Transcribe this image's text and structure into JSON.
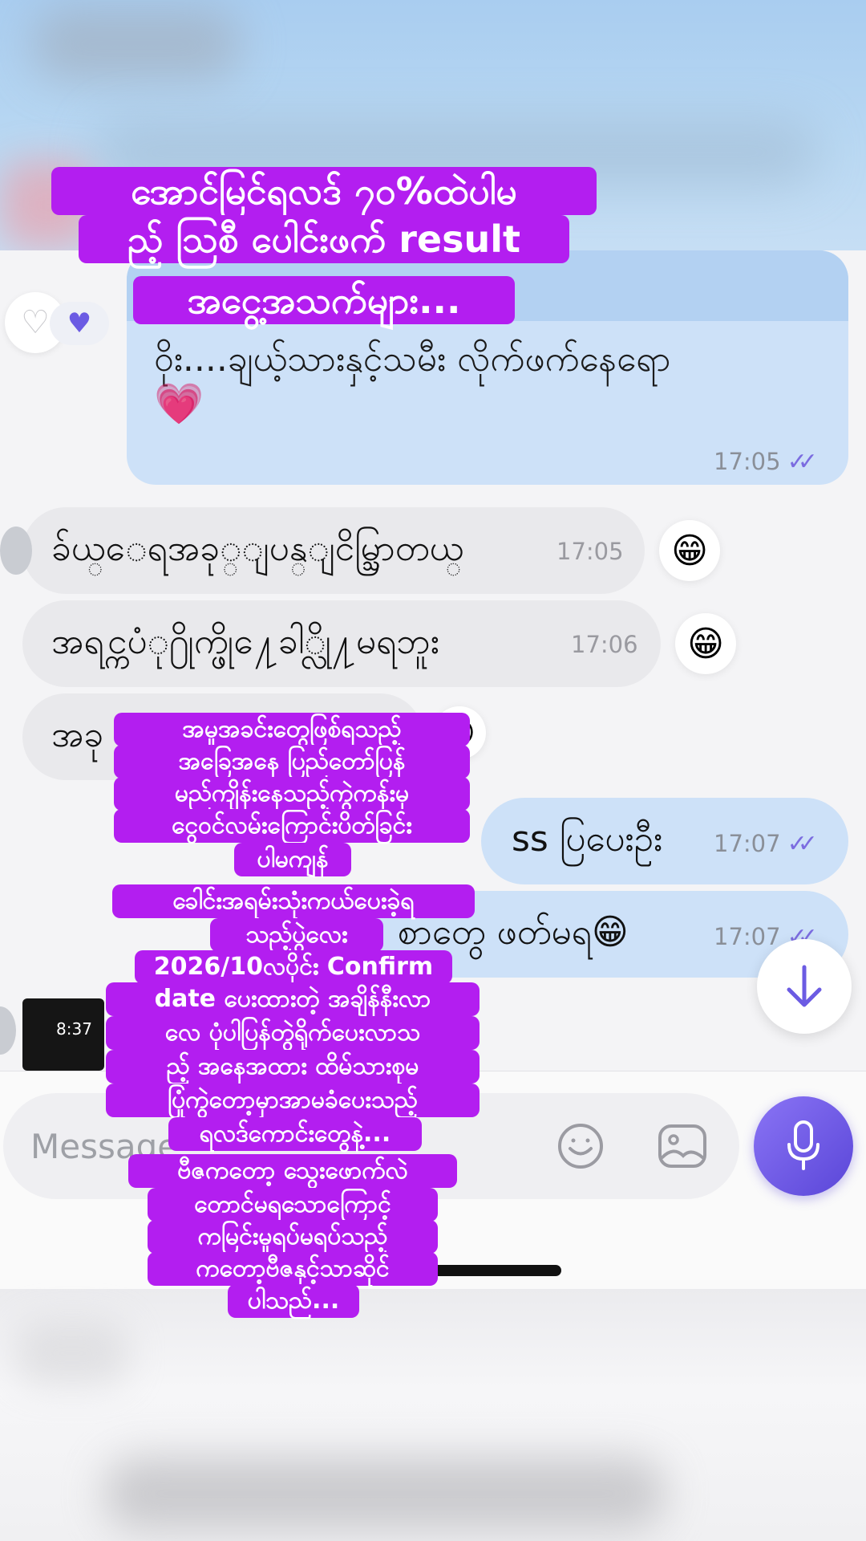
{
  "colors": {
    "accent": "#6b5be3",
    "outgoing_bubble": "#cde1f8",
    "incoming_bubble": "#e9e9ec",
    "caption_bg": "#b31ef0"
  },
  "messages": {
    "outgoing_long": {
      "text": "ဝိုး....ချယ့်သားနှင့်သမီး  လိုက်ဖက်နေရော",
      "emoji": "💗",
      "time": "17:05",
      "status_icon": "double-check-icon"
    },
    "incoming": [
      {
        "text": "ခ်ယ္ေရအခု္ျပန္ျငိမ္သြာတယ္",
        "time": "17:05",
        "reaction": "😁"
      },
      {
        "text": "အရင္ကပံု႐ိုက္ဖို႔ေခါ္လို႔မရဘူး",
        "time": "17:06",
        "reaction": "😁"
      },
      {
        "text": "အခု",
        "time": "",
        "reaction": "😁"
      }
    ],
    "outgoing_short": [
      {
        "text": "ss ပြပေးဦး",
        "time": "17:07",
        "status_icon": "double-check-icon"
      },
      {
        "text": "စာတွေ ဖတ်မရ😁",
        "time": "17:07",
        "status_icon": "double-check-icon"
      }
    ],
    "thumbnail_time": "8:37"
  },
  "composer": {
    "placeholder": "Message"
  },
  "captions": {
    "top": [
      "အောင်မြင်ရလဒ် ၇၀%ထဲပါမ",
      "ည့် ဩစီ ပေါင်းဖက် result",
      "အငွေ့အသက်များ..."
    ],
    "middle": [
      "အမှုအခင်းတွေဖြစ်ရသည့်",
      "အခြေအနေ ပြည်တော်ပြန်",
      "မည်ကျိန်းနေသည့်ကွဲကန်းမှ",
      "ငွေဝင်လမ်းကြောင်းပိတ်ခြင်း",
      "ပါမကျန်",
      "ခေါင်းအရမ်းသုံးကယ်ပေးခဲ့ရ",
      "သည့်ပွဲလေး",
      "2026/10လပိုင်း Confirm",
      "date ပေးထားတဲ့ အချိန်နီးလာ",
      "လေ ပုံပါပြန်တွဲရိုက်ပေးလာသ",
      "ည့် အနေအထား ထိမ်သားစုမ",
      "ပြုံကွဲတော့မှာအာမခံပေးသည့်",
      "ရလဒ်ကောင်းတွေနဲ့...",
      "ဗီဇကတော့ သွေးဖောက်လဲ",
      "တောင်မရသောကြောင့်",
      "ကမြင်းမှုရပ်မရပ်သည့်",
      "ကတော့ဗီဇနှင့်သာဆိုင်",
      "ပါသည်..."
    ]
  }
}
